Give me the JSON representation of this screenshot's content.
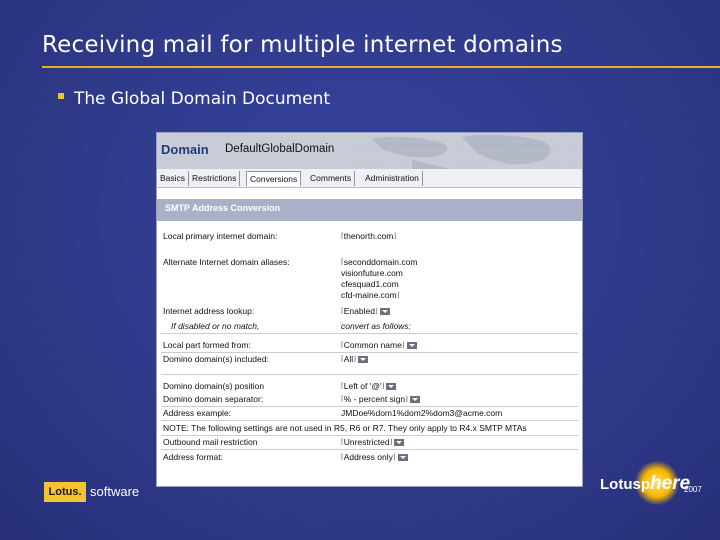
{
  "slide": {
    "title": "Receiving mail for multiple internet domains",
    "bullet": "The Global Domain Document",
    "accent_color": "#e6b021",
    "background_color": "#2f3a8f"
  },
  "screenshot": {
    "header_label": "Domain",
    "domain_name": "DefaultGlobalDomain",
    "tabs": [
      "Basics",
      "Restrictions",
      "Conversions",
      "Comments",
      "Administration"
    ],
    "active_tab": "Conversions",
    "section_title": "SMTP Address Conversion",
    "fields": {
      "primary_domain_label": "Local primary internet domain:",
      "primary_domain_value": "thenorth.com",
      "aliases_label": "Alternate Internet domain aliases:",
      "aliases_values": [
        "seconddomain.com",
        "visionfuture.com",
        "cfesquad1.com",
        "cfd-maine.com"
      ],
      "lookup_label": "Internet address lookup:",
      "lookup_value": "Enabled",
      "lookup_note_label": "If disabled or no match,",
      "lookup_note_value": "convert as follows:",
      "local_part_label": "Local part formed from:",
      "local_part_value": "Common name",
      "domains_included_label": "Domino domain(s) included:",
      "domains_included_value": "All",
      "domain_position_label": "Domino domain(s) position",
      "domain_position_value": "Left of '@'",
      "domain_separator_label": "Domino domain separator:",
      "domain_separator_value": "% - percent sign",
      "address_example_label": "Address example:",
      "address_example_value": "JMDoe%dom1%dom2%dom3@acme.com",
      "note_text": "NOTE: The following settings are not used in R5, R6 or R7. They only apply to R4.x SMTP MTAs",
      "outbound_label": "Outbound mail restriction",
      "outbound_value": "Unrestricted",
      "address_format_label": "Address format:",
      "address_format_value": "Address only"
    }
  },
  "logos": {
    "lotus_box": "Lotus.",
    "lotus_text": "software",
    "lotusphere_prefix": "Lotusp",
    "lotusphere_here": "here",
    "lotusphere_year": "2007"
  }
}
